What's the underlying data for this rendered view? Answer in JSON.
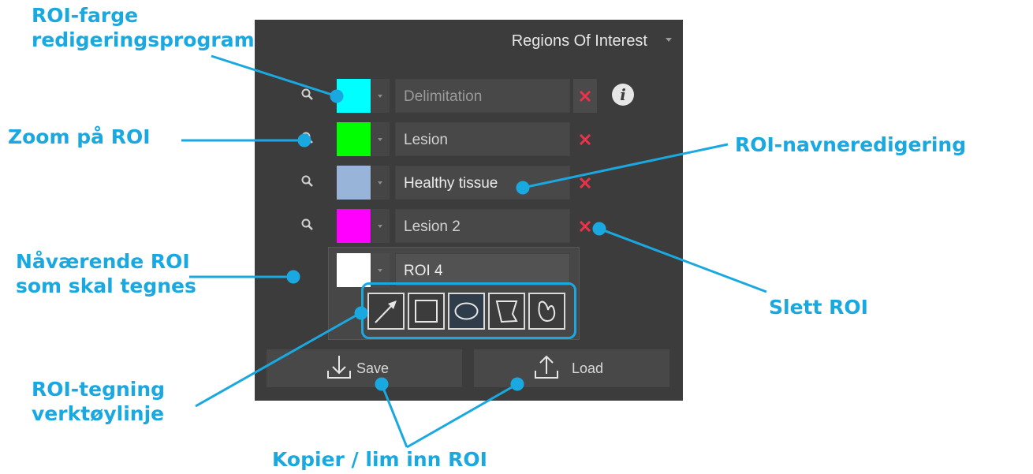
{
  "panel": {
    "title": "Regions Of Interest",
    "rois": [
      {
        "name": "Delimitation",
        "color": "#00ffff"
      },
      {
        "name": "Lesion",
        "color": "#00ff00"
      },
      {
        "name": "Healthy tissue",
        "color": "#99b4d9"
      },
      {
        "name": "Lesion 2",
        "color": "#ff00ff"
      }
    ],
    "current_roi": {
      "name": "ROI 4",
      "color": "#ffffff"
    },
    "info_label": "i",
    "tools": [
      "arrow-tool",
      "rectangle-tool",
      "ellipse-tool",
      "polygon-tool",
      "freehand-tool"
    ],
    "active_tool": "ellipse-tool",
    "save_label": "Save",
    "load_label": "Load"
  },
  "annotations": {
    "color_editor": [
      "ROI-farge",
      "redigeringsprogram"
    ],
    "zoom": "Zoom på ROI",
    "current_roi": [
      "Nåværende ROI",
      "som skal tegnes"
    ],
    "toolbar": [
      "ROI-tegning",
      "verktøylinje"
    ],
    "name_editor": "ROI-navneredigering",
    "delete": "Slett ROI",
    "copy_paste": "Kopier / lim inn ROI"
  },
  "colors": {
    "annotation": "#1aa8e0",
    "panel_bg": "#3c3c3c",
    "delete_x": "#e8334a"
  }
}
